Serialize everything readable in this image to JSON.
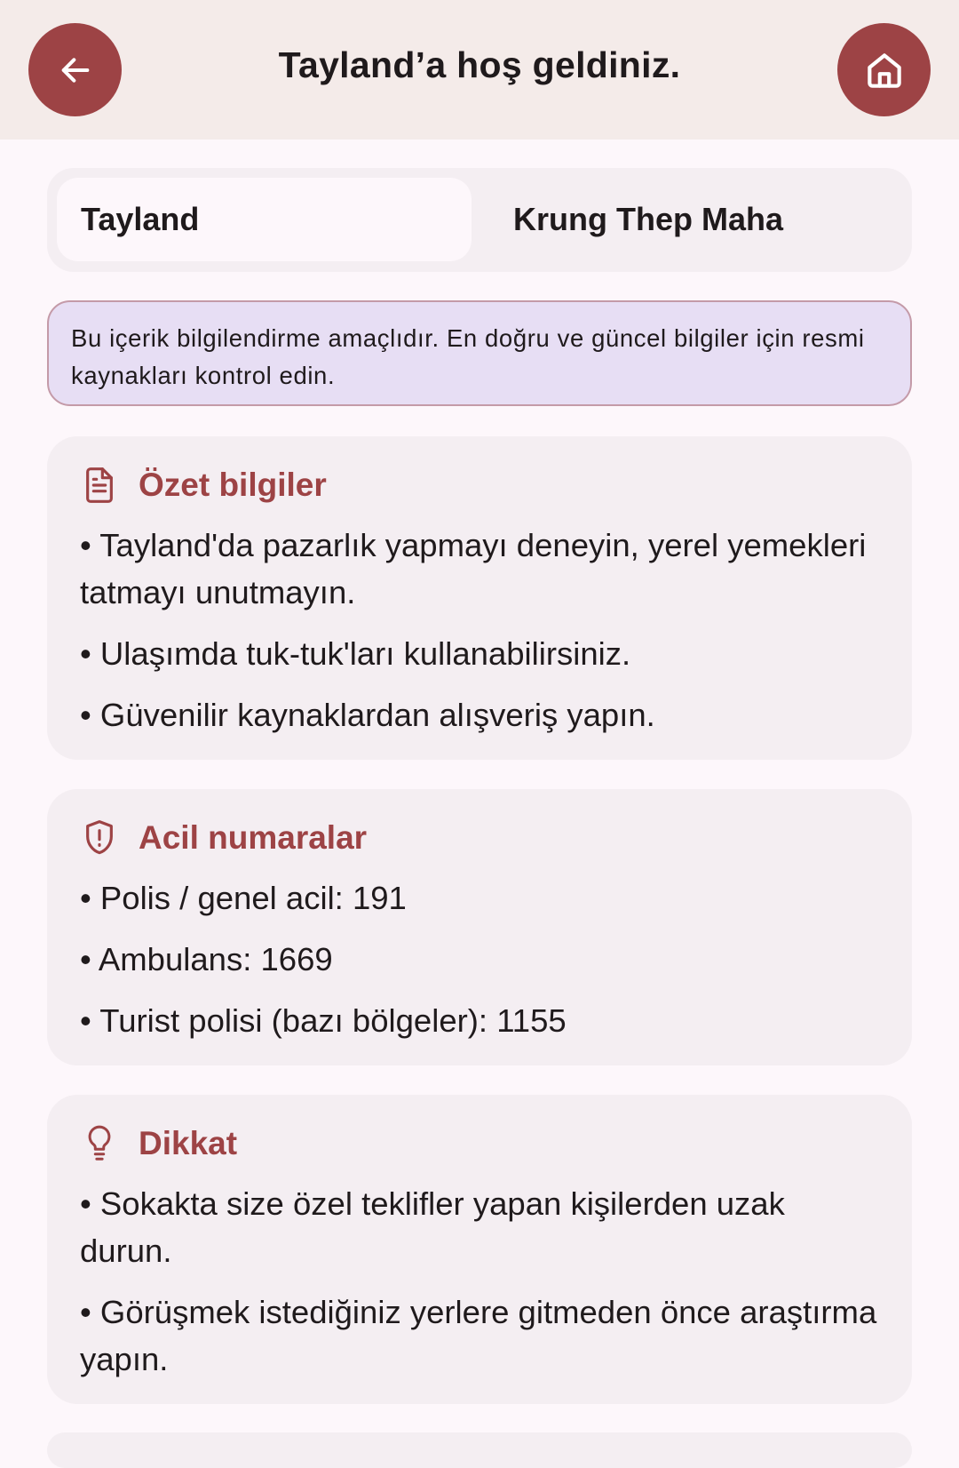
{
  "header": {
    "title": "Tayland’a hoş geldiniz.",
    "back_icon": "arrow-left-icon",
    "home_icon": "home-icon",
    "accent_color": "#9d4345"
  },
  "tabs": [
    {
      "label": "Tayland",
      "selected": true
    },
    {
      "label": "Krung Thep Maha",
      "selected": false
    }
  ],
  "notice": {
    "text": "Bu içerik bilgilendirme amaçlıdır. En doğru ve güncel bilgiler için resmi kaynakları kontrol edin."
  },
  "sections": [
    {
      "title": "Özet bilgiler",
      "icon": "document-icon",
      "items": [
        "Tayland'da pazarlık yapmayı deneyin, yerel yemekleri tatmayı unutmayın.",
        "Ulaşımda tuk-tuk'ları kullanabilirsiniz.",
        "Güvenilir kaynaklardan alışveriş yapın."
      ]
    },
    {
      "title": "Acil numaralar",
      "icon": "shield-alert-icon",
      "items": [
        "Polis / genel acil: 191",
        "Ambulans: 1669",
        "Turist polisi (bazı bölgeler): 1155"
      ]
    },
    {
      "title": "Dikkat",
      "icon": "lightbulb-icon",
      "items": [
        "Sokakta size özel teklifler yapan kişilerden uzak durun.",
        "Görüşmek istediğiniz yerlere gitmeden önce araştırma yapın."
      ]
    }
  ]
}
